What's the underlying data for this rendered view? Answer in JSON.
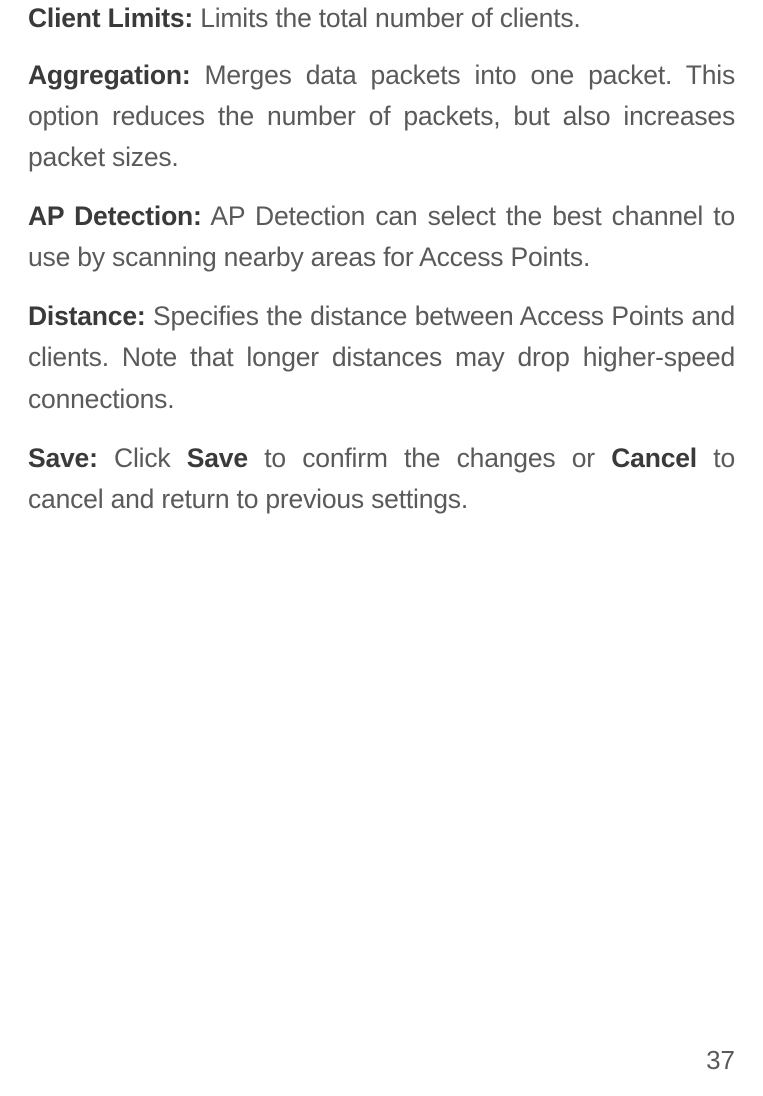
{
  "entries": {
    "client_limits": {
      "term": "Client Limits:",
      "desc": " Limits the total number of clients."
    },
    "aggregation": {
      "term": "Aggregation:",
      "desc": " Merges data packets into one packet. This option reduces the number of packets, but also increases packet sizes."
    },
    "ap_detection": {
      "term": "AP Detection:",
      "desc": " AP Detection can select the best channel to use by scanning nearby areas for Access Points."
    },
    "distance": {
      "term": "Distance:",
      "desc": " Specifies the distance between Access Points and clients. Note that longer distances may drop higher-speed connections."
    },
    "save": {
      "term": "Save:",
      "part1": " Click ",
      "bold1": "Save",
      "part2": " to confirm the changes or ",
      "bold2": "Cancel",
      "part3": " to cancel and return to previous settings."
    }
  },
  "page_number": "37"
}
